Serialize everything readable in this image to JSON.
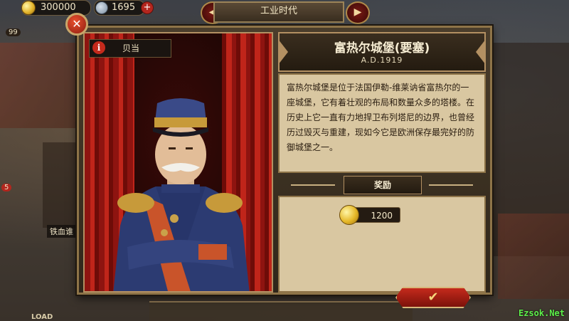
{
  "hud": {
    "gold_amount": "300000",
    "medal_amount": "1695",
    "plus_label": "+",
    "era_title": "工业时代",
    "level_badge": "99",
    "side_badge": "5",
    "side_label": "铁血谁",
    "load_label": "LOAD",
    "watermark": "Ezsok.Net"
  },
  "dialog": {
    "close_label": "✕",
    "portrait": {
      "info_label": "i",
      "name": "贝当"
    },
    "title": "富热尔城堡(要塞)",
    "subtitle": "A.D.1919",
    "description": "富热尔城堡是位于法国伊勒-维莱讷省富热尔的一座城堡，它有着壮观的布局和数量众多的塔楼。在历史上它一直有力地捍卫布列塔尼的边界，也曾经历过毁灭与重建，现如今它是欧洲保存最完好的防御城堡之一。",
    "reward": {
      "header": "奖励",
      "amount": "1200"
    },
    "confirm_label": "✔"
  },
  "colors": {
    "frame_gold": "#b39062",
    "parchment": "#d9c7a1",
    "button_red": "#c42a1c"
  }
}
